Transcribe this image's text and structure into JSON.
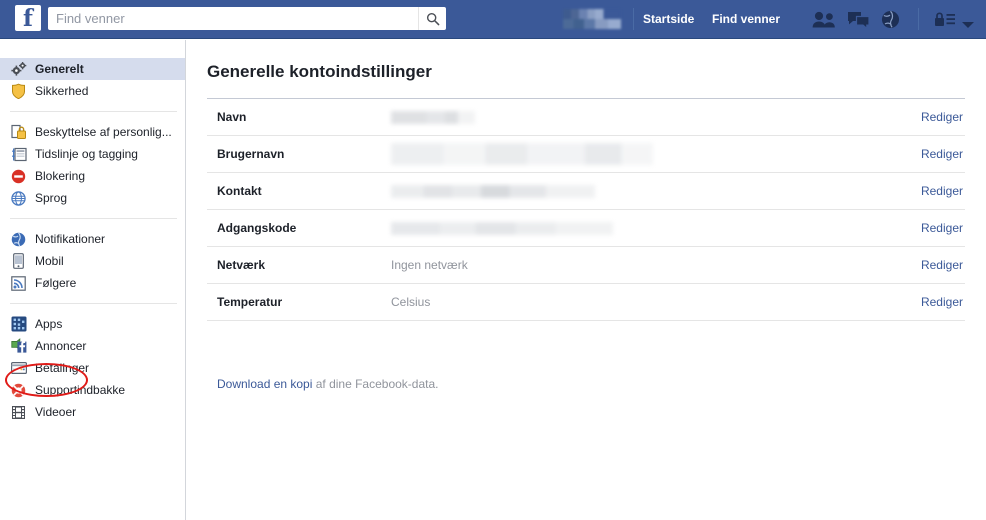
{
  "topbar": {
    "logo_text": "f",
    "search": {
      "placeholder": "Find venner",
      "value": "",
      "icon": "search-icon"
    },
    "profile_name": "",
    "links": [
      {
        "label": "Startside",
        "name": "home-link"
      },
      {
        "label": "Find venner",
        "name": "find-friends-link"
      }
    ],
    "icons": [
      {
        "name": "friend-requests-icon"
      },
      {
        "name": "messages-icon"
      },
      {
        "name": "notifications-globe-icon"
      },
      {
        "name": "privacy-lock-icon"
      },
      {
        "name": "account-dropdown-caret-icon"
      }
    ],
    "colors": {
      "bar_background": "#3b5998",
      "bar_border": "#29487d",
      "icon_fill": "#1d2f55"
    }
  },
  "sidebar": {
    "groups": [
      {
        "items": [
          {
            "label": "Generelt",
            "icon": "gears-icon",
            "selected": true
          },
          {
            "label": "Sikkerhed",
            "icon": "shield-icon",
            "selected": false
          }
        ]
      },
      {
        "items": [
          {
            "label": "Beskyttelse af personlig...",
            "icon": "padlock-icon",
            "selected": false
          },
          {
            "label": "Tidslinje og tagging",
            "icon": "timeline-icon",
            "selected": false
          },
          {
            "label": "Blokering",
            "icon": "block-icon",
            "selected": false
          },
          {
            "label": "Sprog",
            "icon": "globe-icon",
            "selected": false
          }
        ]
      },
      {
        "items": [
          {
            "label": "Notifikationer",
            "icon": "notifications-globe-icon",
            "selected": false
          },
          {
            "label": "Mobil",
            "icon": "mobile-phone-icon",
            "selected": false
          },
          {
            "label": "Følgere",
            "icon": "rss-feed-icon",
            "selected": false
          }
        ]
      },
      {
        "items": [
          {
            "label": "Apps",
            "icon": "apps-grid-icon",
            "selected": false
          },
          {
            "label": "Annoncer",
            "icon": "facebook-ads-icon",
            "selected": false
          },
          {
            "label": "Betalinger",
            "icon": "credit-card-icon",
            "selected": false
          },
          {
            "label": "Supportindbakke",
            "icon": "lifebuoy-icon",
            "selected": false
          },
          {
            "label": "Videoer",
            "icon": "film-strip-icon",
            "selected": false
          }
        ]
      }
    ],
    "annotation": {
      "shape": "ellipse",
      "target_label": "Apps",
      "color": "#e01b18"
    }
  },
  "main": {
    "title": "Generelle kontoindstillinger",
    "edit_label": "Rediger",
    "rows": [
      {
        "label": "Navn",
        "value": "",
        "blurred": true,
        "blur_class": "blur-a"
      },
      {
        "label": "Brugernavn",
        "value": "",
        "blurred": true,
        "blur_class": "blur-b"
      },
      {
        "label": "Kontakt",
        "value": "",
        "blurred": true,
        "blur_class": "blur-c"
      },
      {
        "label": "Adgangskode",
        "value": "",
        "blurred": true,
        "blur_class": "blur-d"
      },
      {
        "label": "Netværk",
        "value": "Ingen netværk",
        "blurred": false,
        "blur_class": ""
      },
      {
        "label": "Temperatur",
        "value": "Celsius",
        "blurred": false,
        "blur_class": ""
      }
    ],
    "download": {
      "link_text": "Download en kopi",
      "rest_text": " af dine Facebook-data."
    }
  }
}
